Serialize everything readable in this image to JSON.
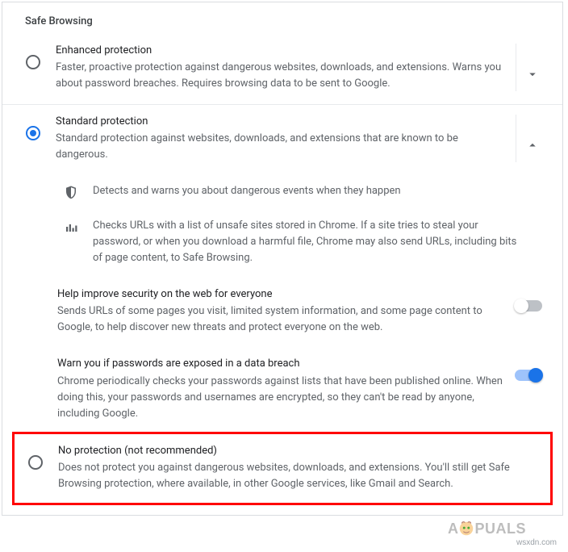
{
  "section_title": "Safe Browsing",
  "options": {
    "enhanced": {
      "title": "Enhanced protection",
      "desc": "Faster, proactive protection against dangerous websites, downloads, and extensions. Warns you about password breaches. Requires browsing data to be sent to Google.",
      "selected": false,
      "expanded": false
    },
    "standard": {
      "title": "Standard protection",
      "desc": "Standard protection against websites, downloads, and extensions that are known to be dangerous.",
      "selected": true,
      "expanded": true,
      "details": {
        "shield": "Detects and warns you about dangerous events when they happen",
        "bars": "Checks URLs with a list of unsafe sites stored in Chrome. If a site tries to steal your password, or when you download a harmful file, Chrome may also send URLs, including bits of page content, to Safe Browsing."
      },
      "sub": {
        "help": {
          "title": "Help improve security on the web for everyone",
          "desc": "Sends URLs of some pages you visit, limited system information, and some page content to Google, to help discover new threats and protect everyone on the web.",
          "on": false
        },
        "warn": {
          "title": "Warn you if passwords are exposed in a data breach",
          "desc": "Chrome periodically checks your passwords against lists that have been published online. When doing this, your passwords and usernames are encrypted, so they can't be read by anyone, including Google.",
          "on": true
        }
      }
    },
    "none": {
      "title": "No protection (not recommended)",
      "desc": "Does not protect you against dangerous websites, downloads, and extensions. You'll still get Safe Browsing protection, where available, in other Google services, like Gmail and Search.",
      "selected": false
    }
  },
  "watermark": {
    "site": "wsxdn.com",
    "brand_pre": "A",
    "brand_post": "PUALS"
  }
}
